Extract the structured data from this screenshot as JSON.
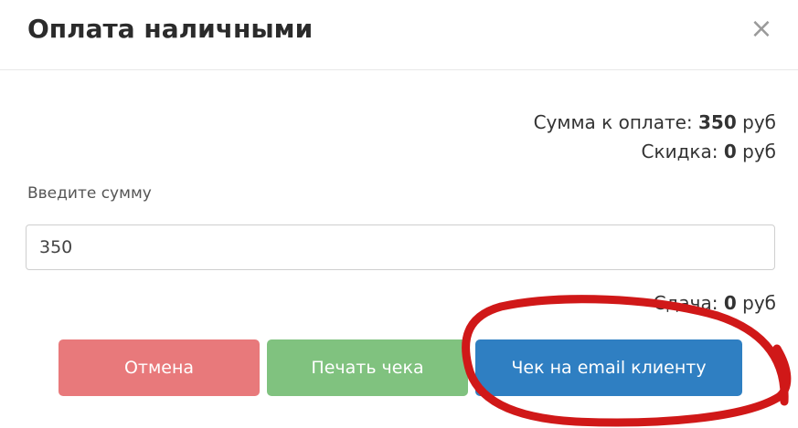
{
  "modal": {
    "title": "Оплата наличными",
    "close_symbol": "×"
  },
  "summary": {
    "total_label": "Сумма к оплате:",
    "total_value": "350",
    "total_unit": "руб",
    "discount_label": "Скидка:",
    "discount_value": "0",
    "discount_unit": "руб"
  },
  "amount_field": {
    "label": "Введите сумму",
    "value": "350"
  },
  "change": {
    "label": "Сдача:",
    "value": "0",
    "unit": "руб"
  },
  "buttons": {
    "cancel": "Отмена",
    "print": "Печать чека",
    "email": "Чек на email клиенту"
  },
  "colors": {
    "cancel": "#e8797b",
    "print": "#80c27f",
    "email": "#2f7fc2",
    "annotation": "#d01818"
  },
  "icons": {
    "close": "close-icon"
  }
}
